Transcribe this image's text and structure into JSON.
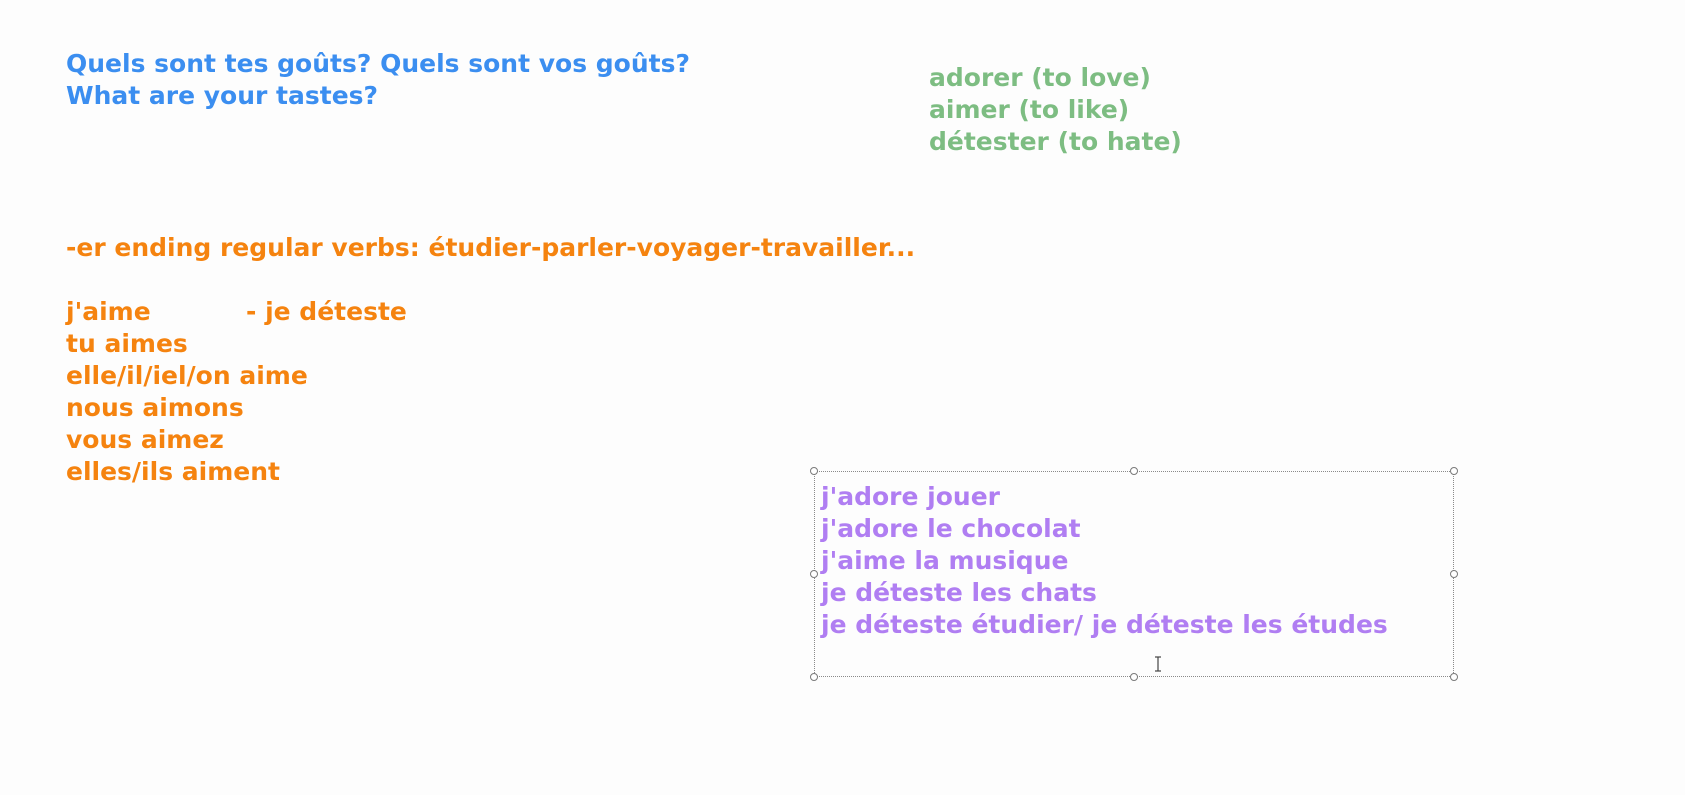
{
  "title_lines": [
    "Quels sont tes goûts? Quels sont vos goûts?",
    "What are your tastes?"
  ],
  "verbs_list": [
    "adorer (to love)",
    "aimer (to like)",
    "détester (to hate)"
  ],
  "er_verbs_line": "-er ending regular verbs: étudier-parler-voyager-travailler...",
  "conjugation": [
    {
      "text": "j'aime",
      "second": "- je déteste"
    },
    {
      "text": "tu aimes"
    },
    {
      "text": "elle/il/iel/on aime"
    },
    {
      "text": "nous aimons"
    },
    {
      "text": "vous aimez"
    },
    {
      "text": "elles/ils aiment"
    }
  ],
  "textbox_lines": [
    "j'adore jouer",
    "j'adore le chocolat",
    "j'aime la musique",
    "je déteste les chats",
    "je déteste étudier/ je déteste les études"
  ],
  "colors": {
    "title": "#3b8ef0",
    "verbs": "#7dbd82",
    "conjugation": "#f5830f",
    "examples": "#b07ef2"
  },
  "icons": {
    "text_cursor": "text-cursor-icon"
  }
}
